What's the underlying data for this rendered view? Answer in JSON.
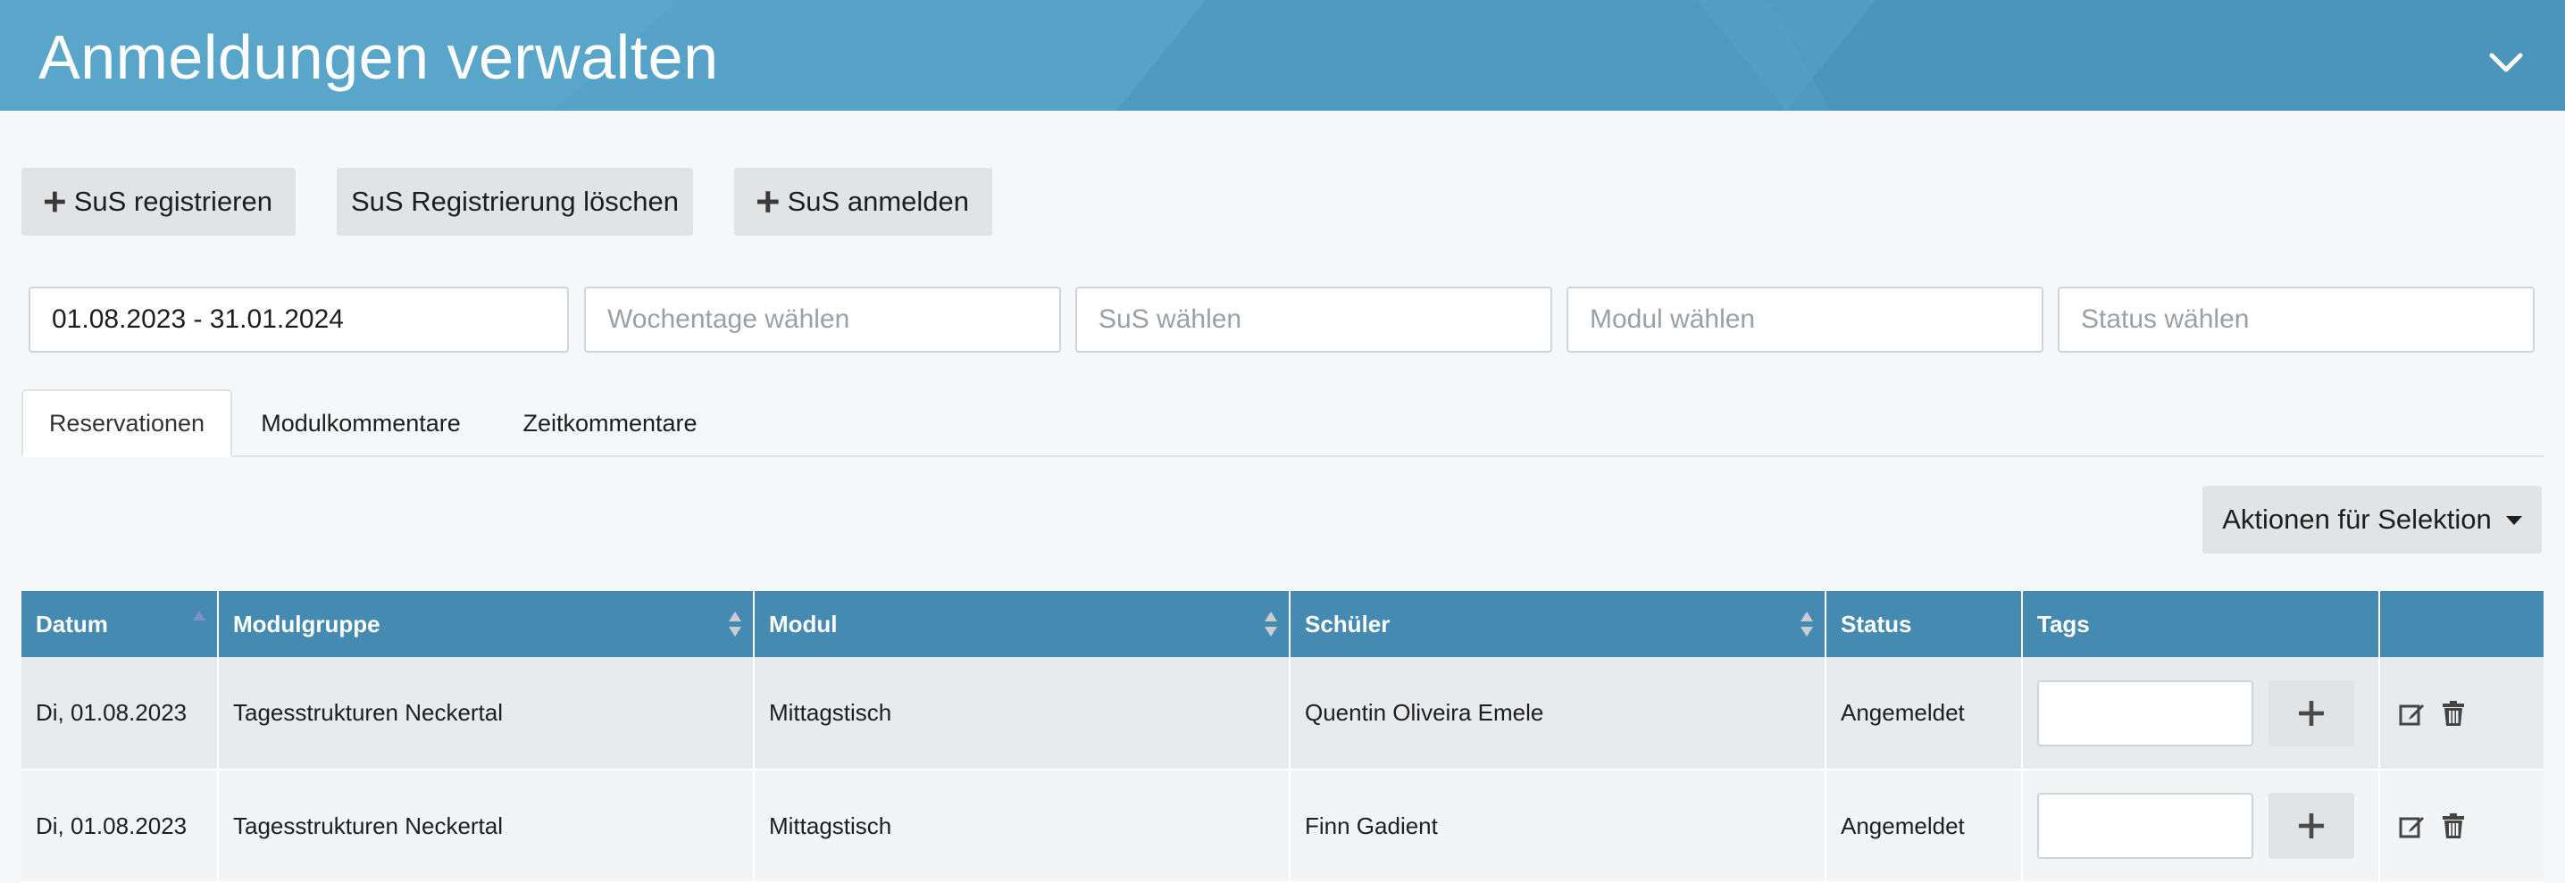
{
  "header": {
    "title": "Anmeldungen verwalten",
    "color": "#4d9ac0",
    "collapse_icon": "chevron-down-icon"
  },
  "actions": {
    "register_label": "SuS registrieren",
    "delete_label": "SuS Registrierung löschen",
    "enroll_label": "SuS anmelden"
  },
  "filters": {
    "date_value": "01.08.2023 - 31.01.2024",
    "weekday_placeholder": "Wochentage wählen",
    "student_placeholder": "SuS wählen",
    "module_placeholder": "Modul wählen",
    "status_placeholder": "Status wählen"
  },
  "tabs": [
    {
      "label": "Reservationen",
      "active": true
    },
    {
      "label": "Modulkommentare",
      "active": false
    },
    {
      "label": "Zeitkommentare",
      "active": false
    }
  ],
  "selection_actions_label": "Aktionen für Selektion",
  "table": {
    "header_color": "#458bb1",
    "columns": [
      "Datum",
      "Modulgruppe",
      "Modul",
      "Schüler",
      "Status",
      "Tags",
      ""
    ],
    "rows": [
      {
        "date": "Di, 01.08.2023",
        "module_group": "Tagesstrukturen Neckertal",
        "module": "Mittagstisch",
        "student": "Quentin Oliveira Emele",
        "status": "Angemeldet"
      },
      {
        "date": "Di, 01.08.2023",
        "module_group": "Tagesstrukturen Neckertal",
        "module": "Mittagstisch",
        "student": "Finn Gadient",
        "status": "Angemeldet"
      }
    ]
  }
}
